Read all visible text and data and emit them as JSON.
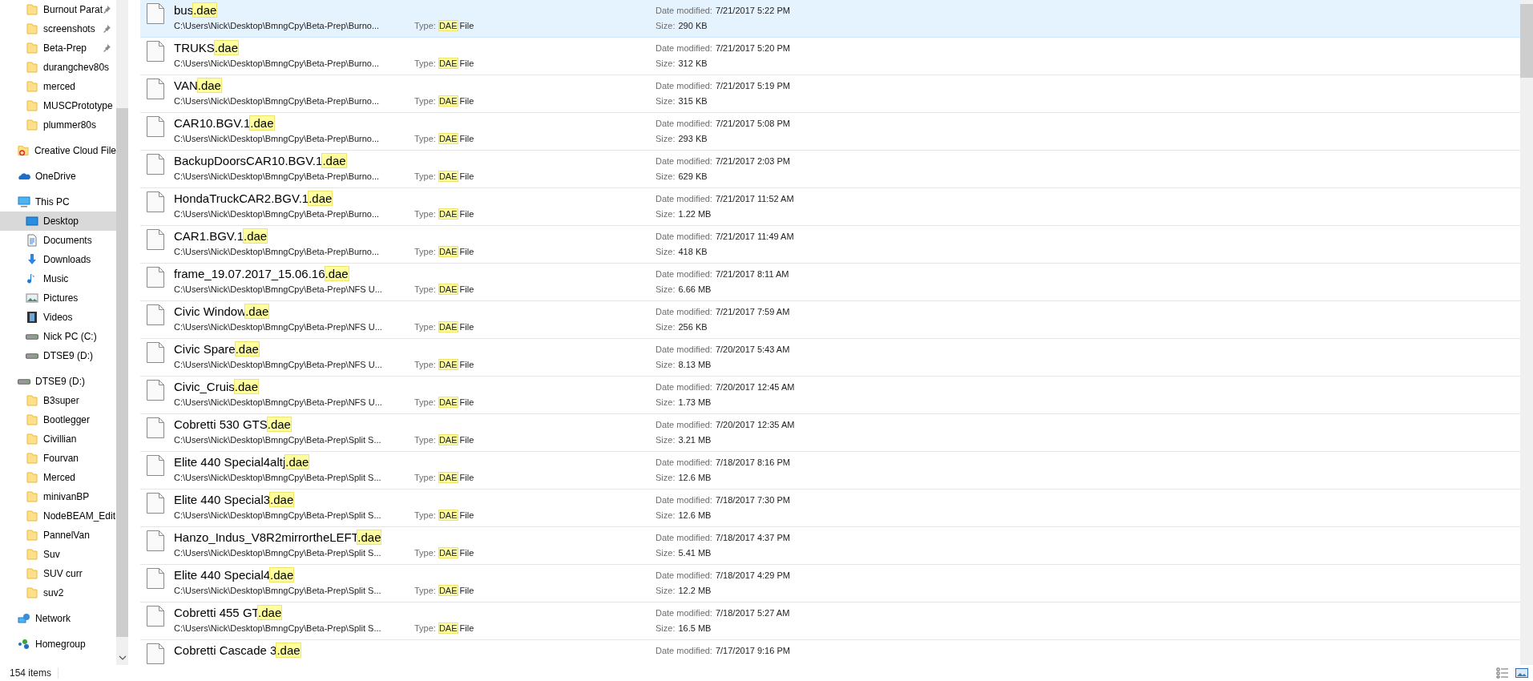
{
  "sidebar": {
    "pinned_folders": [
      {
        "label": "Burnout Parat",
        "pinned": true
      },
      {
        "label": "screenshots",
        "pinned": true
      },
      {
        "label": "Beta-Prep",
        "pinned": true
      },
      {
        "label": "durangchev80s",
        "pinned": false
      },
      {
        "label": "merced",
        "pinned": false
      },
      {
        "label": "MUSCPrototype",
        "pinned": false
      },
      {
        "label": "plummer80s",
        "pinned": false
      }
    ],
    "items": [
      {
        "kind": "creative",
        "label": "Creative Cloud File",
        "selected": false
      },
      {
        "kind": "cloud",
        "label": "OneDrive",
        "selected": false
      },
      {
        "kind": "pc",
        "label": "This PC",
        "selected": false,
        "children": [
          {
            "kind": "desktop",
            "label": "Desktop",
            "selected": true
          },
          {
            "kind": "documents",
            "label": "Documents",
            "selected": false
          },
          {
            "kind": "downloads",
            "label": "Downloads",
            "selected": false
          },
          {
            "kind": "music",
            "label": "Music",
            "selected": false
          },
          {
            "kind": "pictures",
            "label": "Pictures",
            "selected": false
          },
          {
            "kind": "videos",
            "label": "Videos",
            "selected": false
          },
          {
            "kind": "drive",
            "label": "Nick PC (C:)",
            "selected": false
          },
          {
            "kind": "drive",
            "label": "DTSE9 (D:)",
            "selected": false
          }
        ]
      },
      {
        "kind": "drive",
        "label": "DTSE9 (D:)",
        "selected": false,
        "children": [
          {
            "kind": "folder",
            "label": "B3super",
            "selected": false
          },
          {
            "kind": "folder",
            "label": "Bootlegger",
            "selected": false
          },
          {
            "kind": "folder",
            "label": "Civillian",
            "selected": false
          },
          {
            "kind": "folder",
            "label": "Fourvan",
            "selected": false
          },
          {
            "kind": "folder",
            "label": "Merced",
            "selected": false
          },
          {
            "kind": "folder",
            "label": "minivanBP",
            "selected": false
          },
          {
            "kind": "folder",
            "label": "NodeBEAM_Edit",
            "selected": false
          },
          {
            "kind": "folder",
            "label": "PannelVan",
            "selected": false
          },
          {
            "kind": "folder",
            "label": "Suv",
            "selected": false
          },
          {
            "kind": "folder",
            "label": "SUV curr",
            "selected": false
          },
          {
            "kind": "folder",
            "label": "suv2",
            "selected": false
          }
        ]
      },
      {
        "kind": "network",
        "label": "Network",
        "selected": false
      },
      {
        "kind": "homegroup",
        "label": "Homegroup",
        "selected": false
      }
    ]
  },
  "files": [
    {
      "stem": "bus",
      "match": ".dae",
      "path": "C:\\Users\\Nick\\Desktop\\BmngCpy\\Beta-Prep\\Burno...",
      "type_label": "Type:",
      "type_match": "DAE",
      "type_rest": "File",
      "date_label": "Date modified:",
      "date": "7/21/2017 5:22 PM",
      "size_label": "Size:",
      "size": "290 KB",
      "selected": true
    },
    {
      "stem": "TRUKS",
      "match": ".dae",
      "path": "C:\\Users\\Nick\\Desktop\\BmngCpy\\Beta-Prep\\Burno...",
      "type_label": "Type:",
      "type_match": "DAE",
      "type_rest": "File",
      "date_label": "Date modified:",
      "date": "7/21/2017 5:20 PM",
      "size_label": "Size:",
      "size": "312 KB",
      "selected": false
    },
    {
      "stem": "VAN",
      "match": ".dae",
      "path": "C:\\Users\\Nick\\Desktop\\BmngCpy\\Beta-Prep\\Burno...",
      "type_label": "Type:",
      "type_match": "DAE",
      "type_rest": "File",
      "date_label": "Date modified:",
      "date": "7/21/2017 5:19 PM",
      "size_label": "Size:",
      "size": "315 KB",
      "selected": false
    },
    {
      "stem": "CAR10.BGV.1",
      "match": ".dae",
      "path": "C:\\Users\\Nick\\Desktop\\BmngCpy\\Beta-Prep\\Burno...",
      "type_label": "Type:",
      "type_match": "DAE",
      "type_rest": "File",
      "date_label": "Date modified:",
      "date": "7/21/2017 5:08 PM",
      "size_label": "Size:",
      "size": "293 KB",
      "selected": false
    },
    {
      "stem": "BackupDoorsCAR10.BGV.1",
      "match": ".dae",
      "path": "C:\\Users\\Nick\\Desktop\\BmngCpy\\Beta-Prep\\Burno...",
      "type_label": "Type:",
      "type_match": "DAE",
      "type_rest": "File",
      "date_label": "Date modified:",
      "date": "7/21/2017 2:03 PM",
      "size_label": "Size:",
      "size": "629 KB",
      "selected": false
    },
    {
      "stem": "HondaTruckCAR2.BGV.1",
      "match": ".dae",
      "path": "C:\\Users\\Nick\\Desktop\\BmngCpy\\Beta-Prep\\Burno...",
      "type_label": "Type:",
      "type_match": "DAE",
      "type_rest": "File",
      "date_label": "Date modified:",
      "date": "7/21/2017 11:52 AM",
      "size_label": "Size:",
      "size": "1.22 MB",
      "selected": false
    },
    {
      "stem": "CAR1.BGV.1",
      "match": ".dae",
      "path": "C:\\Users\\Nick\\Desktop\\BmngCpy\\Beta-Prep\\Burno...",
      "type_label": "Type:",
      "type_match": "DAE",
      "type_rest": "File",
      "date_label": "Date modified:",
      "date": "7/21/2017 11:49 AM",
      "size_label": "Size:",
      "size": "418 KB",
      "selected": false
    },
    {
      "stem": "frame_19.07.2017_15.06.16",
      "match": ".dae",
      "path": "C:\\Users\\Nick\\Desktop\\BmngCpy\\Beta-Prep\\NFS U...",
      "type_label": "Type:",
      "type_match": "DAE",
      "type_rest": "File",
      "date_label": "Date modified:",
      "date": "7/21/2017 8:11 AM",
      "size_label": "Size:",
      "size": "6.66 MB",
      "selected": false
    },
    {
      "stem": "Civic Window",
      "match": ".dae",
      "path": "C:\\Users\\Nick\\Desktop\\BmngCpy\\Beta-Prep\\NFS U...",
      "type_label": "Type:",
      "type_match": "DAE",
      "type_rest": "File",
      "date_label": "Date modified:",
      "date": "7/21/2017 7:59 AM",
      "size_label": "Size:",
      "size": "256 KB",
      "selected": false
    },
    {
      "stem": "Civic Spare",
      "match": ".dae",
      "path": "C:\\Users\\Nick\\Desktop\\BmngCpy\\Beta-Prep\\NFS U...",
      "type_label": "Type:",
      "type_match": "DAE",
      "type_rest": "File",
      "date_label": "Date modified:",
      "date": "7/20/2017 5:43 AM",
      "size_label": "Size:",
      "size": "8.13 MB",
      "selected": false
    },
    {
      "stem": "Civic_Cruis",
      "match": ".dae",
      "path": "C:\\Users\\Nick\\Desktop\\BmngCpy\\Beta-Prep\\NFS U...",
      "type_label": "Type:",
      "type_match": "DAE",
      "type_rest": "File",
      "date_label": "Date modified:",
      "date": "7/20/2017 12:45 AM",
      "size_label": "Size:",
      "size": "1.73 MB",
      "selected": false
    },
    {
      "stem": "Cobretti 530 GTS",
      "match": ".dae",
      "path": "C:\\Users\\Nick\\Desktop\\BmngCpy\\Beta-Prep\\Split S...",
      "type_label": "Type:",
      "type_match": "DAE",
      "type_rest": "File",
      "date_label": "Date modified:",
      "date": "7/20/2017 12:35 AM",
      "size_label": "Size:",
      "size": "3.21 MB",
      "selected": false
    },
    {
      "stem": "Elite 440 Special4altj",
      "match": ".dae",
      "path": "C:\\Users\\Nick\\Desktop\\BmngCpy\\Beta-Prep\\Split S...",
      "type_label": "Type:",
      "type_match": "DAE",
      "type_rest": "File",
      "date_label": "Date modified:",
      "date": "7/18/2017 8:16 PM",
      "size_label": "Size:",
      "size": "12.6 MB",
      "selected": false
    },
    {
      "stem": "Elite 440 Special3",
      "match": ".dae",
      "path": "C:\\Users\\Nick\\Desktop\\BmngCpy\\Beta-Prep\\Split S...",
      "type_label": "Type:",
      "type_match": "DAE",
      "type_rest": "File",
      "date_label": "Date modified:",
      "date": "7/18/2017 7:30 PM",
      "size_label": "Size:",
      "size": "12.6 MB",
      "selected": false
    },
    {
      "stem": "Hanzo_Indus_V8R2mirrortheLEFT",
      "match": ".dae",
      "path": "C:\\Users\\Nick\\Desktop\\BmngCpy\\Beta-Prep\\Split S...",
      "type_label": "Type:",
      "type_match": "DAE",
      "type_rest": "File",
      "date_label": "Date modified:",
      "date": "7/18/2017 4:37 PM",
      "size_label": "Size:",
      "size": "5.41 MB",
      "selected": false
    },
    {
      "stem": "Elite 440 Special4",
      "match": ".dae",
      "path": "C:\\Users\\Nick\\Desktop\\BmngCpy\\Beta-Prep\\Split S...",
      "type_label": "Type:",
      "type_match": "DAE",
      "type_rest": "File",
      "date_label": "Date modified:",
      "date": "7/18/2017 4:29 PM",
      "size_label": "Size:",
      "size": "12.2 MB",
      "selected": false
    },
    {
      "stem": "Cobretti 455 GT",
      "match": ".dae",
      "path": "C:\\Users\\Nick\\Desktop\\BmngCpy\\Beta-Prep\\Split S...",
      "type_label": "Type:",
      "type_match": "DAE",
      "type_rest": "File",
      "date_label": "Date modified:",
      "date": "7/18/2017 5:27 AM",
      "size_label": "Size:",
      "size": "16.5 MB",
      "selected": false
    },
    {
      "stem": "Cobretti Cascade 3",
      "match": ".dae",
      "date_label": "Date modified:",
      "date": "7/17/2017 9:16 PM",
      "selected": false
    }
  ],
  "status_bar": {
    "item_count": "154 items"
  }
}
